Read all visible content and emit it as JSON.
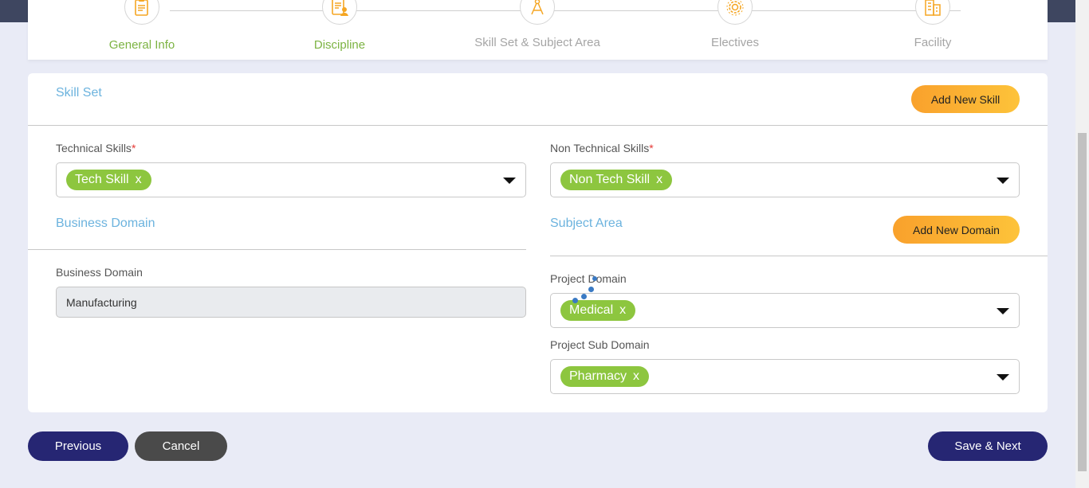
{
  "stepper": {
    "steps": [
      {
        "label": "General Info",
        "status": "done",
        "icon": "clipboard-icon"
      },
      {
        "label": "Discipline",
        "status": "done",
        "icon": "document-user-icon"
      },
      {
        "label": "Skill Set & Subject Area",
        "status": "pending",
        "icon": "compass-icon"
      },
      {
        "label": "Electives",
        "status": "pending",
        "icon": "gear-icon"
      },
      {
        "label": "Facility",
        "status": "pending",
        "icon": "building-icon"
      }
    ]
  },
  "skill_set": {
    "title": "Skill Set",
    "add_button": "Add New Skill",
    "technical": {
      "label": "Technical Skills",
      "required_mark": "*",
      "chip": "Tech Skill",
      "chip_remove": "x"
    },
    "non_technical": {
      "label": "Non Technical Skills",
      "required_mark": "*",
      "chip": "Non Tech Skill",
      "chip_remove": "x"
    }
  },
  "business_domain": {
    "title": "Business Domain",
    "field_label": "Business Domain",
    "value": "Manufacturing"
  },
  "subject_area": {
    "title": "Subject Area",
    "add_button": "Add New Domain",
    "project_domain": {
      "label": "Project Domain",
      "chip": "Medical",
      "chip_remove": "x"
    },
    "project_sub_domain": {
      "label": "Project Sub Domain",
      "chip": "Pharmacy",
      "chip_remove": "x"
    }
  },
  "footer": {
    "previous": "Previous",
    "cancel": "Cancel",
    "save_next": "Save & Next"
  },
  "colors": {
    "accent_green": "#8dc63f",
    "section_blue": "#6cb3de",
    "navy": "#262673",
    "orange": "#f9a12c"
  }
}
